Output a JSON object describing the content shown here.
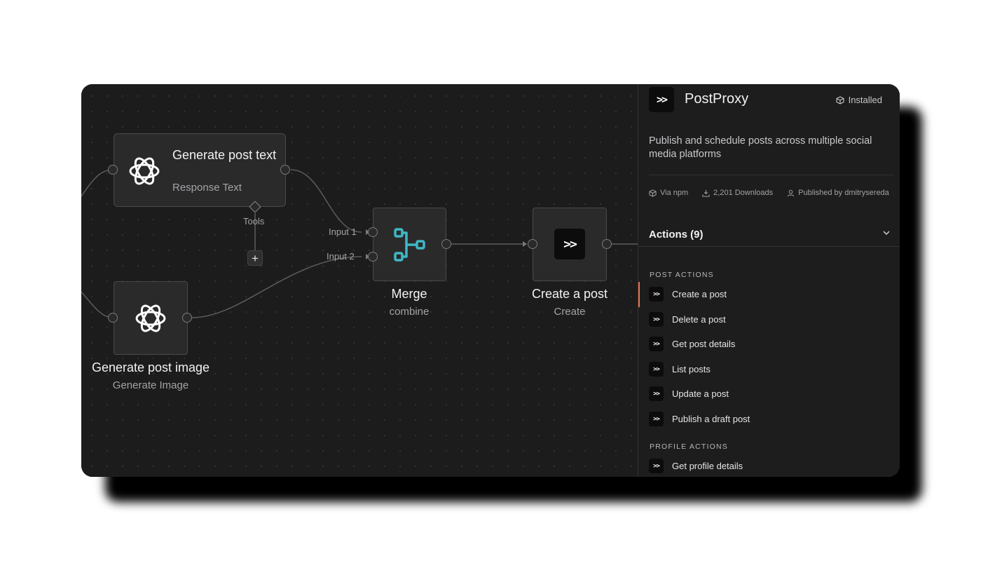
{
  "canvas": {
    "nodes": {
      "generate_text": {
        "title": "Generate post text",
        "subtitle": "Response Text",
        "tools_label": "Tools",
        "icon": "openai-icon"
      },
      "generate_image": {
        "title": "Generate post image",
        "subtitle": "Generate Image",
        "icon": "openai-icon"
      },
      "merge": {
        "title": "Merge",
        "subtitle": "combine",
        "input1": "Input 1",
        "input2": "Input 2",
        "icon": "merge-icon"
      },
      "create_post": {
        "title": "Create a post",
        "subtitle": "Create",
        "icon": "postproxy-logo"
      }
    },
    "add_tool_label": "+"
  },
  "panel": {
    "title": "PostProxy",
    "installed": "Installed",
    "description": "Publish and schedule posts across multiple social media platforms",
    "meta": {
      "source": "Via npm",
      "downloads": "2,201 Downloads",
      "publisher": "Published by dmitrysereda"
    },
    "actions_header": "Actions (9)",
    "sections": [
      {
        "title": "POST ACTIONS",
        "items": [
          "Create a post",
          "Delete a post",
          "Get post details",
          "List posts",
          "Update a post",
          "Publish a draft post"
        ]
      },
      {
        "title": "PROFILE ACTIONS",
        "items": [
          "Get profile details"
        ]
      }
    ]
  },
  "colors": {
    "accent": "#e8744f",
    "merge_icon": "#3fb8c4",
    "background": "#1c1c1d"
  }
}
